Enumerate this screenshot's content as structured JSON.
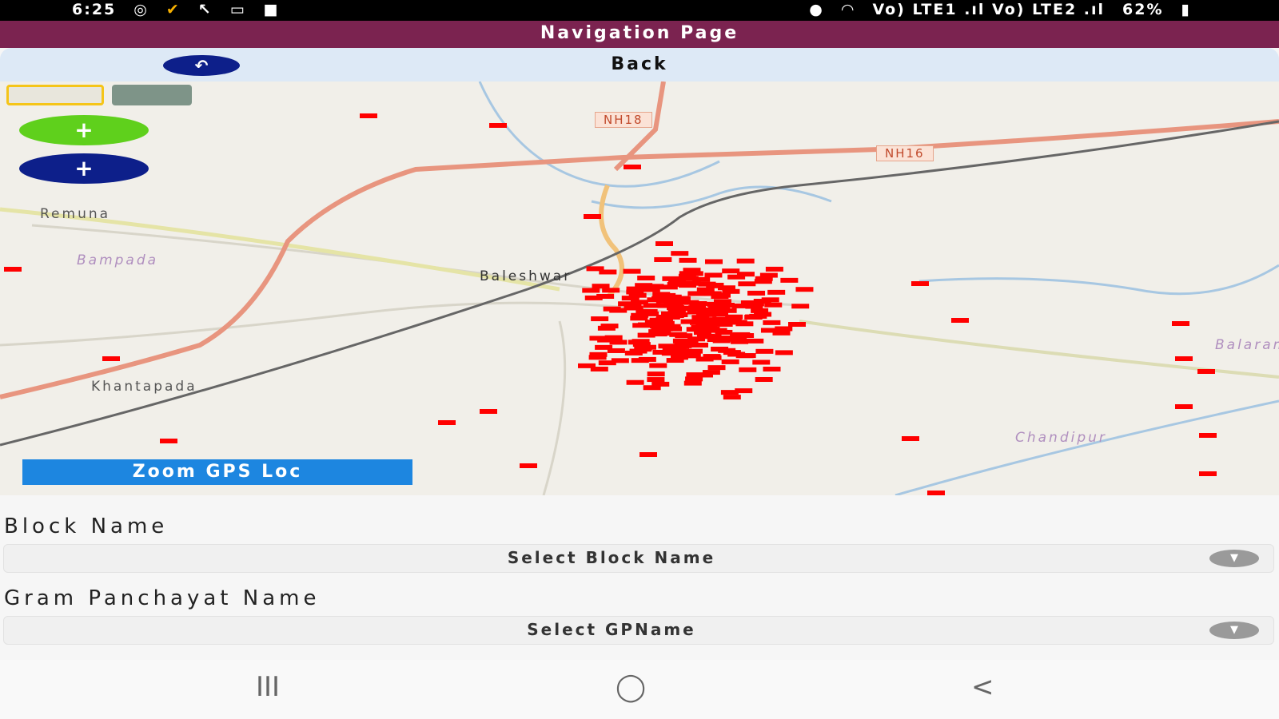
{
  "status_bar": {
    "time": "6:25",
    "network": "Vo) LTE1 .ıl Vo) LTE2 .ıl",
    "battery": "62%"
  },
  "header": {
    "title": "Navigation Page",
    "back_label": "Back"
  },
  "map": {
    "place_labels": [
      "Remuna",
      "Bampada",
      "Baleshwar",
      "Khantapada",
      "Chandipur",
      "Balaramgadi"
    ],
    "road_labels": [
      "NH18",
      "NH16"
    ],
    "zoom_gps_label": "Zoom GPS Loc",
    "marker_color": "#ff0000"
  },
  "form": {
    "block_label": "Block Name",
    "block_placeholder": "Select Block Name",
    "gp_label": "Gram Panchayat Name",
    "gp_placeholder": "Select GPName"
  },
  "nav_bar": {
    "recents": "III",
    "home": "◯",
    "back": "<"
  },
  "colors": {
    "title_bar": "#7b2350",
    "back_bar": "#dde9f6",
    "zoom_in": "#5fd01c",
    "zoom_out": "#0d1f8a",
    "gps_button": "#1d86e0"
  }
}
